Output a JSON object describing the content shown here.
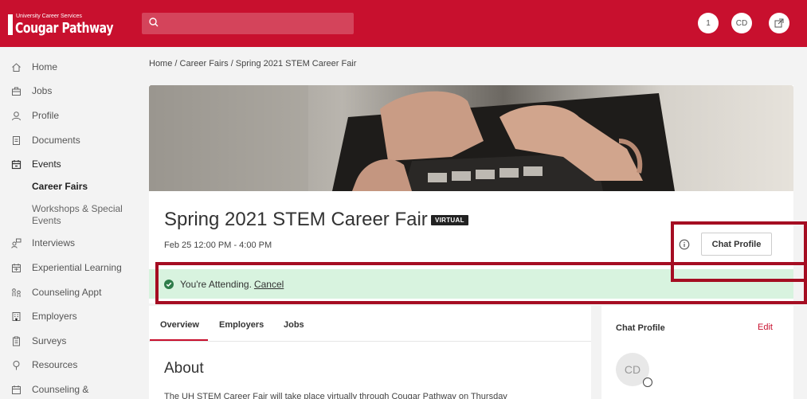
{
  "brand": {
    "small_text": "University Career Services",
    "name": "Cougar Pathway",
    "color": "#c8102e"
  },
  "header": {
    "search_placeholder": "",
    "notification_count": "1",
    "user_initials": "CD",
    "extra_icon": "external-link-icon"
  },
  "sidebar": {
    "items": [
      {
        "label": "Home",
        "icon": "home-icon"
      },
      {
        "label": "Jobs",
        "icon": "briefcase-icon"
      },
      {
        "label": "Profile",
        "icon": "person-icon"
      },
      {
        "label": "Documents",
        "icon": "document-icon"
      },
      {
        "label": "Events",
        "icon": "calendar-icon"
      },
      {
        "label": "Interviews",
        "icon": "interviews-icon"
      },
      {
        "label": "Experiential Learning",
        "icon": "calendar-grid-icon"
      },
      {
        "label": "Counseling Appt",
        "icon": "people-icon"
      },
      {
        "label": "Employers",
        "icon": "building-icon"
      },
      {
        "label": "Surveys",
        "icon": "clipboard-icon"
      },
      {
        "label": "Resources",
        "icon": "pin-icon"
      },
      {
        "label": "Counseling &",
        "icon": "calendar-icon"
      }
    ],
    "events_sub": [
      {
        "label": "Career Fairs"
      },
      {
        "label": "Workshops & Special"
      },
      {
        "label": "Events"
      }
    ]
  },
  "breadcrumb": "Home / Career Fairs / Spring 2021 STEM Career Fair",
  "event": {
    "title": "Spring 2021 STEM Career Fair",
    "badge": "VIRTUAL",
    "datetime": "Feb 25 12:00 PM - 4:00 PM",
    "chat_profile_button": "Chat Profile",
    "attending_text": "You're Attending.",
    "cancel_link": "Cancel"
  },
  "tabs": [
    {
      "label": "Overview"
    },
    {
      "label": "Employers"
    },
    {
      "label": "Jobs"
    }
  ],
  "about": {
    "heading": "About",
    "text": "The UH STEM Career Fair will take place virtually through Cougar Pathway on Thursday"
  },
  "chat_profile_card": {
    "title": "Chat Profile",
    "edit": "Edit",
    "initials": "CD"
  }
}
